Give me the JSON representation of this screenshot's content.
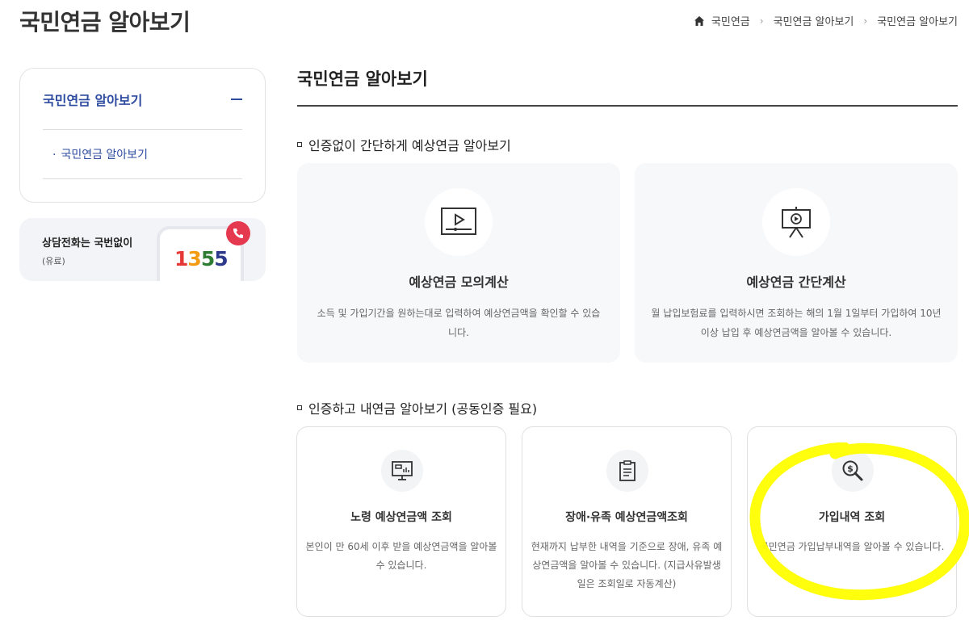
{
  "header": {
    "title": "국민연금 알아보기",
    "breadcrumb": [
      "국민연금",
      "국민연금 알아보기",
      "국민연금 알아보기"
    ]
  },
  "sidebar": {
    "menu_title": "국민연금 알아보기",
    "sub_item": "국민연금 알아보기",
    "call_label": "상담전화는 국번없이",
    "call_paid": "(유료)",
    "call_digits": [
      "1",
      "3",
      "5",
      "5"
    ]
  },
  "main": {
    "title": "국민연금 알아보기",
    "section1": {
      "heading": "인증없이 간단하게 예상연금 알아보기",
      "cards": [
        {
          "icon": "video-play-icon",
          "title": "예상연금 모의계산",
          "desc": "소득 및 가입기간을 원하는대로 입력하여 예상연금액을 확인할 수 있습니다."
        },
        {
          "icon": "presentation-icon",
          "title": "예상연금 간단계산",
          "desc": "월 납입보험료를 입력하시면 조회하는 해의 1월 1일부터 가입하여 10년 이상 납입 후 예상연금액을 알아볼 수 있습니다."
        }
      ]
    },
    "section2": {
      "heading": "인증하고 내연금 알아보기 (공동인증 필요)",
      "cards": [
        {
          "icon": "monitor-chart-icon",
          "title": "노령 예상연금액 조회",
          "desc": "본인이 만 60세 이후 받을 예상연금액을 알아볼 수 있습니다."
        },
        {
          "icon": "clipboard-icon",
          "title": "장애·유족 예상연금액조회",
          "desc": "현재까지 납부한 내역을 기준으로 장애, 유족 예상연금액을 알아볼 수 있습니다. (지급사유발생일은 조회일로 자동계산)"
        },
        {
          "icon": "money-search-icon",
          "title": "가입내역 조회",
          "desc": "국민연금 가입납부내역을 알아볼 수 있습니다."
        }
      ]
    }
  },
  "colors": {
    "accent": "#2d4b9f",
    "highlight": "#ffff00",
    "call": "#e53950"
  }
}
